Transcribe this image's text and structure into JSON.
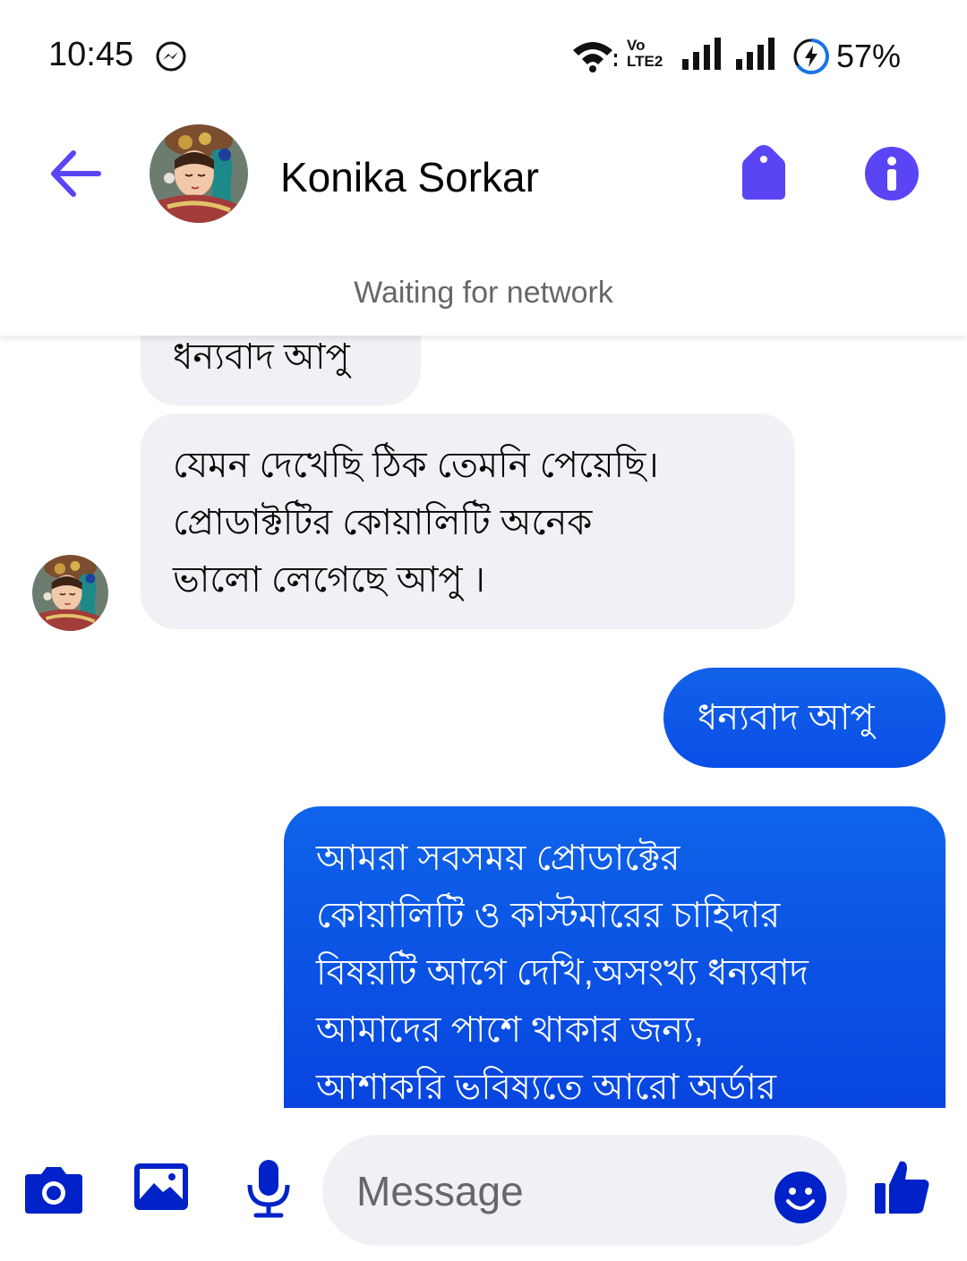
{
  "status_bar": {
    "time": "10:45",
    "network_label_top": "Vo",
    "network_label_bottom": "LTE2",
    "battery_percent": "57%",
    "icons": [
      "messenger-icon",
      "wifi-icon",
      "volte-icon",
      "signal-icon",
      "signal-icon",
      "battery-saver-icon"
    ]
  },
  "header": {
    "contact_name": "Konika Sorkar",
    "status_text": "Waiting for network",
    "icons": [
      "back-arrow-icon",
      "tag-icon",
      "info-icon"
    ]
  },
  "messages": [
    {
      "direction": "incoming",
      "text": "ধন্যবাদ আপু"
    },
    {
      "direction": "incoming",
      "lines": [
        "যেমন দেখেছি ঠিক তেমনি পেয়েছি।",
        "প্রোডাক্টটির কোয়ালিটি অনেক",
        "ভালো লেগেছে আপু ।"
      ]
    },
    {
      "direction": "outgoing",
      "text": "ধন্যবাদ আপু"
    },
    {
      "direction": "outgoing",
      "lines": [
        "আমরা সবসময় প্রোডাক্টের",
        "কোয়ালিটি ও কাস্টমারের চাহিদার",
        "বিষয়টি আগে দেখি,অসংখ্য ধন্যবাদ",
        "আমাদের পাশে থাকার জন্য,",
        "আশাকরি ভবিষ্যতে আরো অর্ডার"
      ]
    }
  ],
  "composer": {
    "placeholder": "Message",
    "icons": [
      "camera-icon",
      "gallery-icon",
      "microphone-icon",
      "emoji-icon",
      "thumbs-up-icon"
    ]
  },
  "colors": {
    "accent": "#5a45f5",
    "outgoing_bubble": "#0a4ee6",
    "incoming_bubble": "#f0f1f5",
    "composer_icons": "#0022c8"
  }
}
